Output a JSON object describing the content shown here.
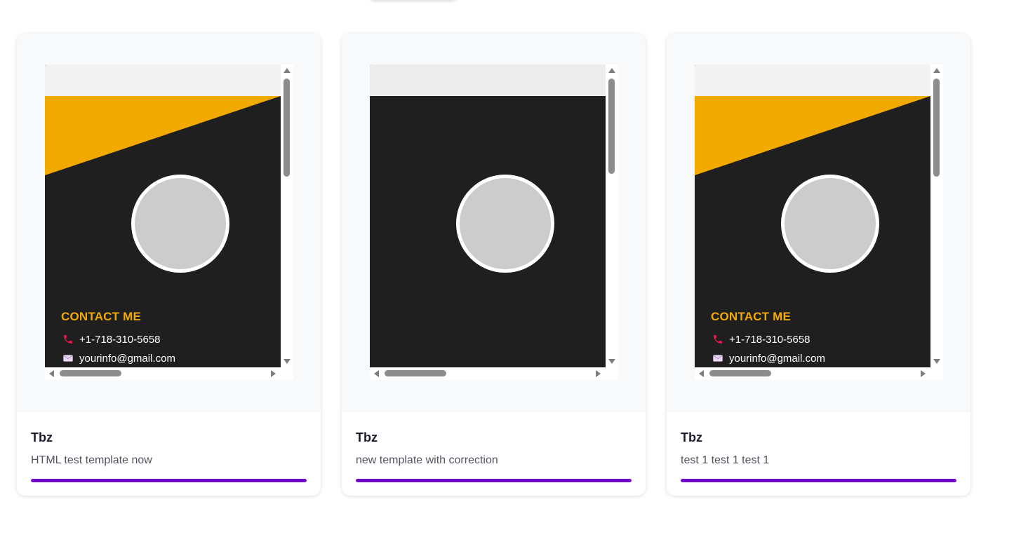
{
  "theme": {
    "accent": "#7008c8",
    "template_yellow": "#f2a900",
    "template_dark": "#1f1f1f"
  },
  "cards": [
    {
      "title": "Tbz",
      "description": "HTML test template now",
      "progress": 1.0,
      "preview": {
        "style": "diagonal",
        "contact_heading": "CONTACT ME",
        "phone": "+1-718-310-5658",
        "email": "yourinfo@gmail.com"
      }
    },
    {
      "title": "Tbz",
      "description": "new template with correction",
      "progress": 1.0,
      "preview": {
        "style": "plain"
      }
    },
    {
      "title": "Tbz",
      "description": "test 1 test 1 test 1",
      "progress": 1.0,
      "preview": {
        "style": "diagonal",
        "contact_heading": "CONTACT ME",
        "phone": "+1-718-310-5658",
        "email": "yourinfo@gmail.com"
      }
    }
  ]
}
